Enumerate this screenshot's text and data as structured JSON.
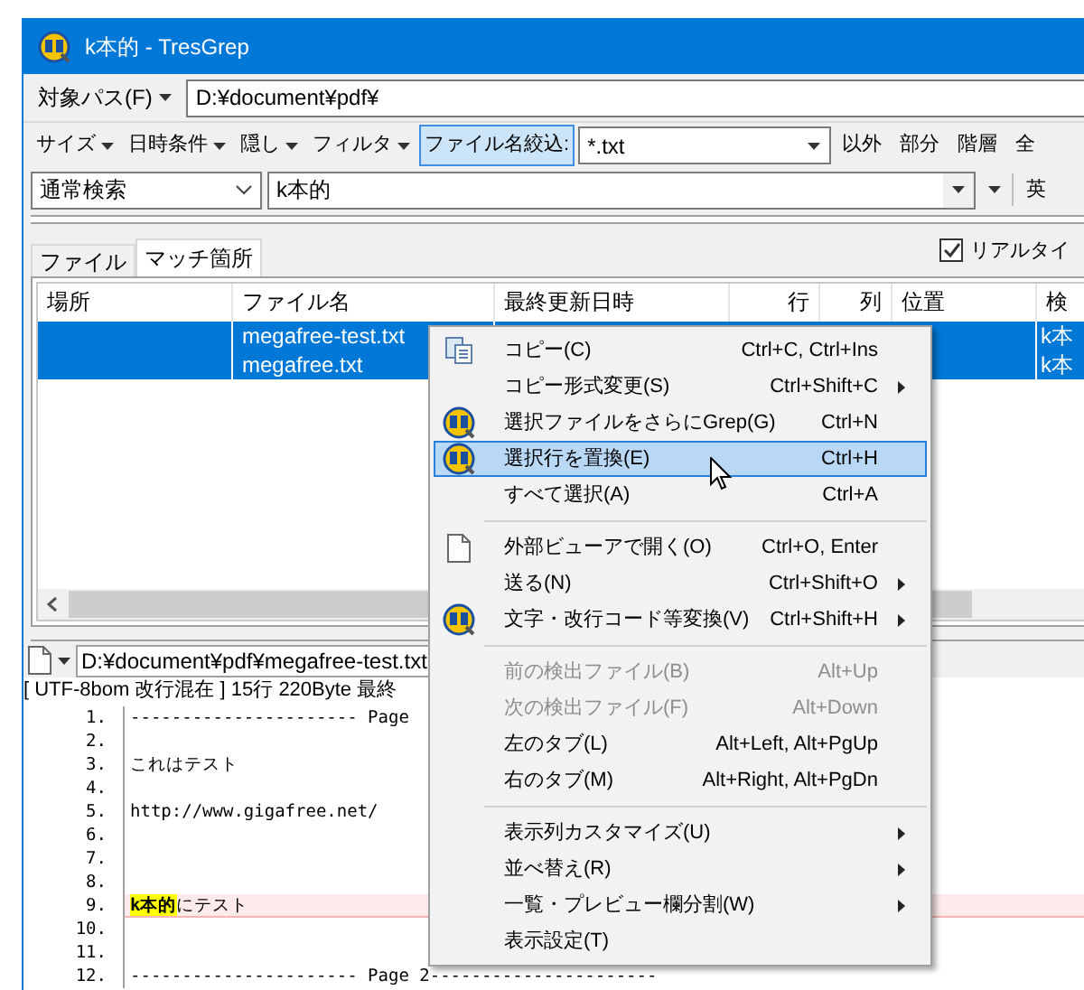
{
  "window": {
    "title": "k本的 - TresGrep"
  },
  "path_bar": {
    "label": "対象パス(F)",
    "value": "D:¥document¥pdf¥"
  },
  "filter_bar": {
    "menus": [
      "サイズ",
      "日時条件",
      "隠し",
      "フィルタ"
    ],
    "filename_filter": {
      "label": "ファイル名絞込:",
      "on": true,
      "value": "*.txt"
    },
    "options": [
      "以外",
      "部分",
      "階層",
      "全"
    ]
  },
  "search_bar": {
    "mode": "通常検索",
    "query": "k本的",
    "options": [
      "英"
    ]
  },
  "tabs": [
    {
      "label": "ファイル",
      "selected": false
    },
    {
      "label": "マッチ箇所",
      "selected": true
    }
  ],
  "realtime_checkbox": {
    "label": "リアルタイ",
    "checked": true
  },
  "table": {
    "columns": [
      "場所",
      "ファイル名",
      "最終更新日時",
      "行",
      "列",
      "位置",
      "検"
    ],
    "rows": [
      {
        "file": "megafree-test.txt",
        "column_7": "k本",
        "selected": true
      },
      {
        "file": "megafree.txt",
        "column_7": "k本",
        "selected": true
      }
    ]
  },
  "preview": {
    "path": "D:¥document¥pdf¥megafree-test.txt",
    "status": "[ UTF-8bom 改行混在 ] 15行 220Byte 最終",
    "lines": [
      {
        "number": "1.",
        "text": "---------------------- Page",
        "highlighted": false
      },
      {
        "number": "2.",
        "highlighted": false
      },
      {
        "number": "3.",
        "text": "これはテスト",
        "highlighted": false
      },
      {
        "number": "4.",
        "highlighted": false
      },
      {
        "number": "5.",
        "text": "http://www.gigafree.net/",
        "highlighted": false
      },
      {
        "number": "6.",
        "highlighted": false
      },
      {
        "number": "7.",
        "highlighted": false
      },
      {
        "number": "8.",
        "highlighted": false
      },
      {
        "number": "9.",
        "match": "k本的",
        "text": "にテスト",
        "highlighted": true
      },
      {
        "number": "10.",
        "highlighted": false
      },
      {
        "number": "11.",
        "highlighted": false
      },
      {
        "number": "12.",
        "text": "---------------------- Page 2----------------------",
        "highlighted": false
      }
    ]
  },
  "context_menu": [
    {
      "kind": "copy_item",
      "label": "コピー(C)",
      "shortcut": "Ctrl+C, Ctrl+Ins",
      "submenu": false,
      "disabled": false,
      "selected": false
    },
    {
      "kind": "item",
      "label": "コピー形式変更(S)",
      "shortcut": "Ctrl+Shift+C",
      "submenu": true,
      "disabled": false,
      "selected": false
    },
    {
      "kind": "app_item",
      "label": "選択ファイルをさらにGrep(G)",
      "shortcut": "Ctrl+N",
      "submenu": false,
      "disabled": false,
      "selected": false
    },
    {
      "kind": "app_item",
      "label": "選択行を置換(E)",
      "shortcut": "Ctrl+H",
      "submenu": false,
      "disabled": false,
      "selected": true
    },
    {
      "kind": "item",
      "label": "すべて選択(A)",
      "shortcut": "Ctrl+A",
      "submenu": false,
      "disabled": false,
      "selected": false
    },
    {
      "kind": "separator"
    },
    {
      "kind": "page_item",
      "label": "外部ビューアで開く(O)",
      "shortcut": "Ctrl+O, Enter",
      "submenu": false,
      "disabled": false,
      "selected": false
    },
    {
      "kind": "item",
      "label": "送る(N)",
      "shortcut": "Ctrl+Shift+O",
      "submenu": true,
      "disabled": false,
      "selected": false
    },
    {
      "kind": "app_item",
      "label": "文字・改行コード等変換(V)",
      "shortcut": "Ctrl+Shift+H",
      "submenu": true,
      "disabled": false,
      "selected": false
    },
    {
      "kind": "separator"
    },
    {
      "kind": "item",
      "label": "前の検出ファイル(B)",
      "shortcut": "Alt+Up",
      "submenu": false,
      "disabled": true,
      "selected": false
    },
    {
      "kind": "item",
      "label": "次の検出ファイル(F)",
      "shortcut": "Alt+Down",
      "submenu": false,
      "disabled": true,
      "selected": false
    },
    {
      "kind": "item",
      "label": "左のタブ(L)",
      "shortcut": "Alt+Left, Alt+PgUp",
      "submenu": false,
      "disabled": false,
      "selected": false
    },
    {
      "kind": "item",
      "label": "右のタブ(M)",
      "shortcut": "Alt+Right, Alt+PgDn",
      "submenu": false,
      "disabled": false,
      "selected": false
    },
    {
      "kind": "separator"
    },
    {
      "kind": "item",
      "label": "表示列カスタマイズ(U)",
      "submenu": true,
      "disabled": false,
      "selected": false
    },
    {
      "kind": "item",
      "label": "並べ替え(R)",
      "submenu": true,
      "disabled": false,
      "selected": false
    },
    {
      "kind": "item",
      "label": "一覧・プレビュー欄分割(W)",
      "submenu": true,
      "disabled": false,
      "selected": false
    },
    {
      "kind": "item",
      "label": "表示設定(T)",
      "submenu": false,
      "disabled": false,
      "selected": false
    }
  ]
}
